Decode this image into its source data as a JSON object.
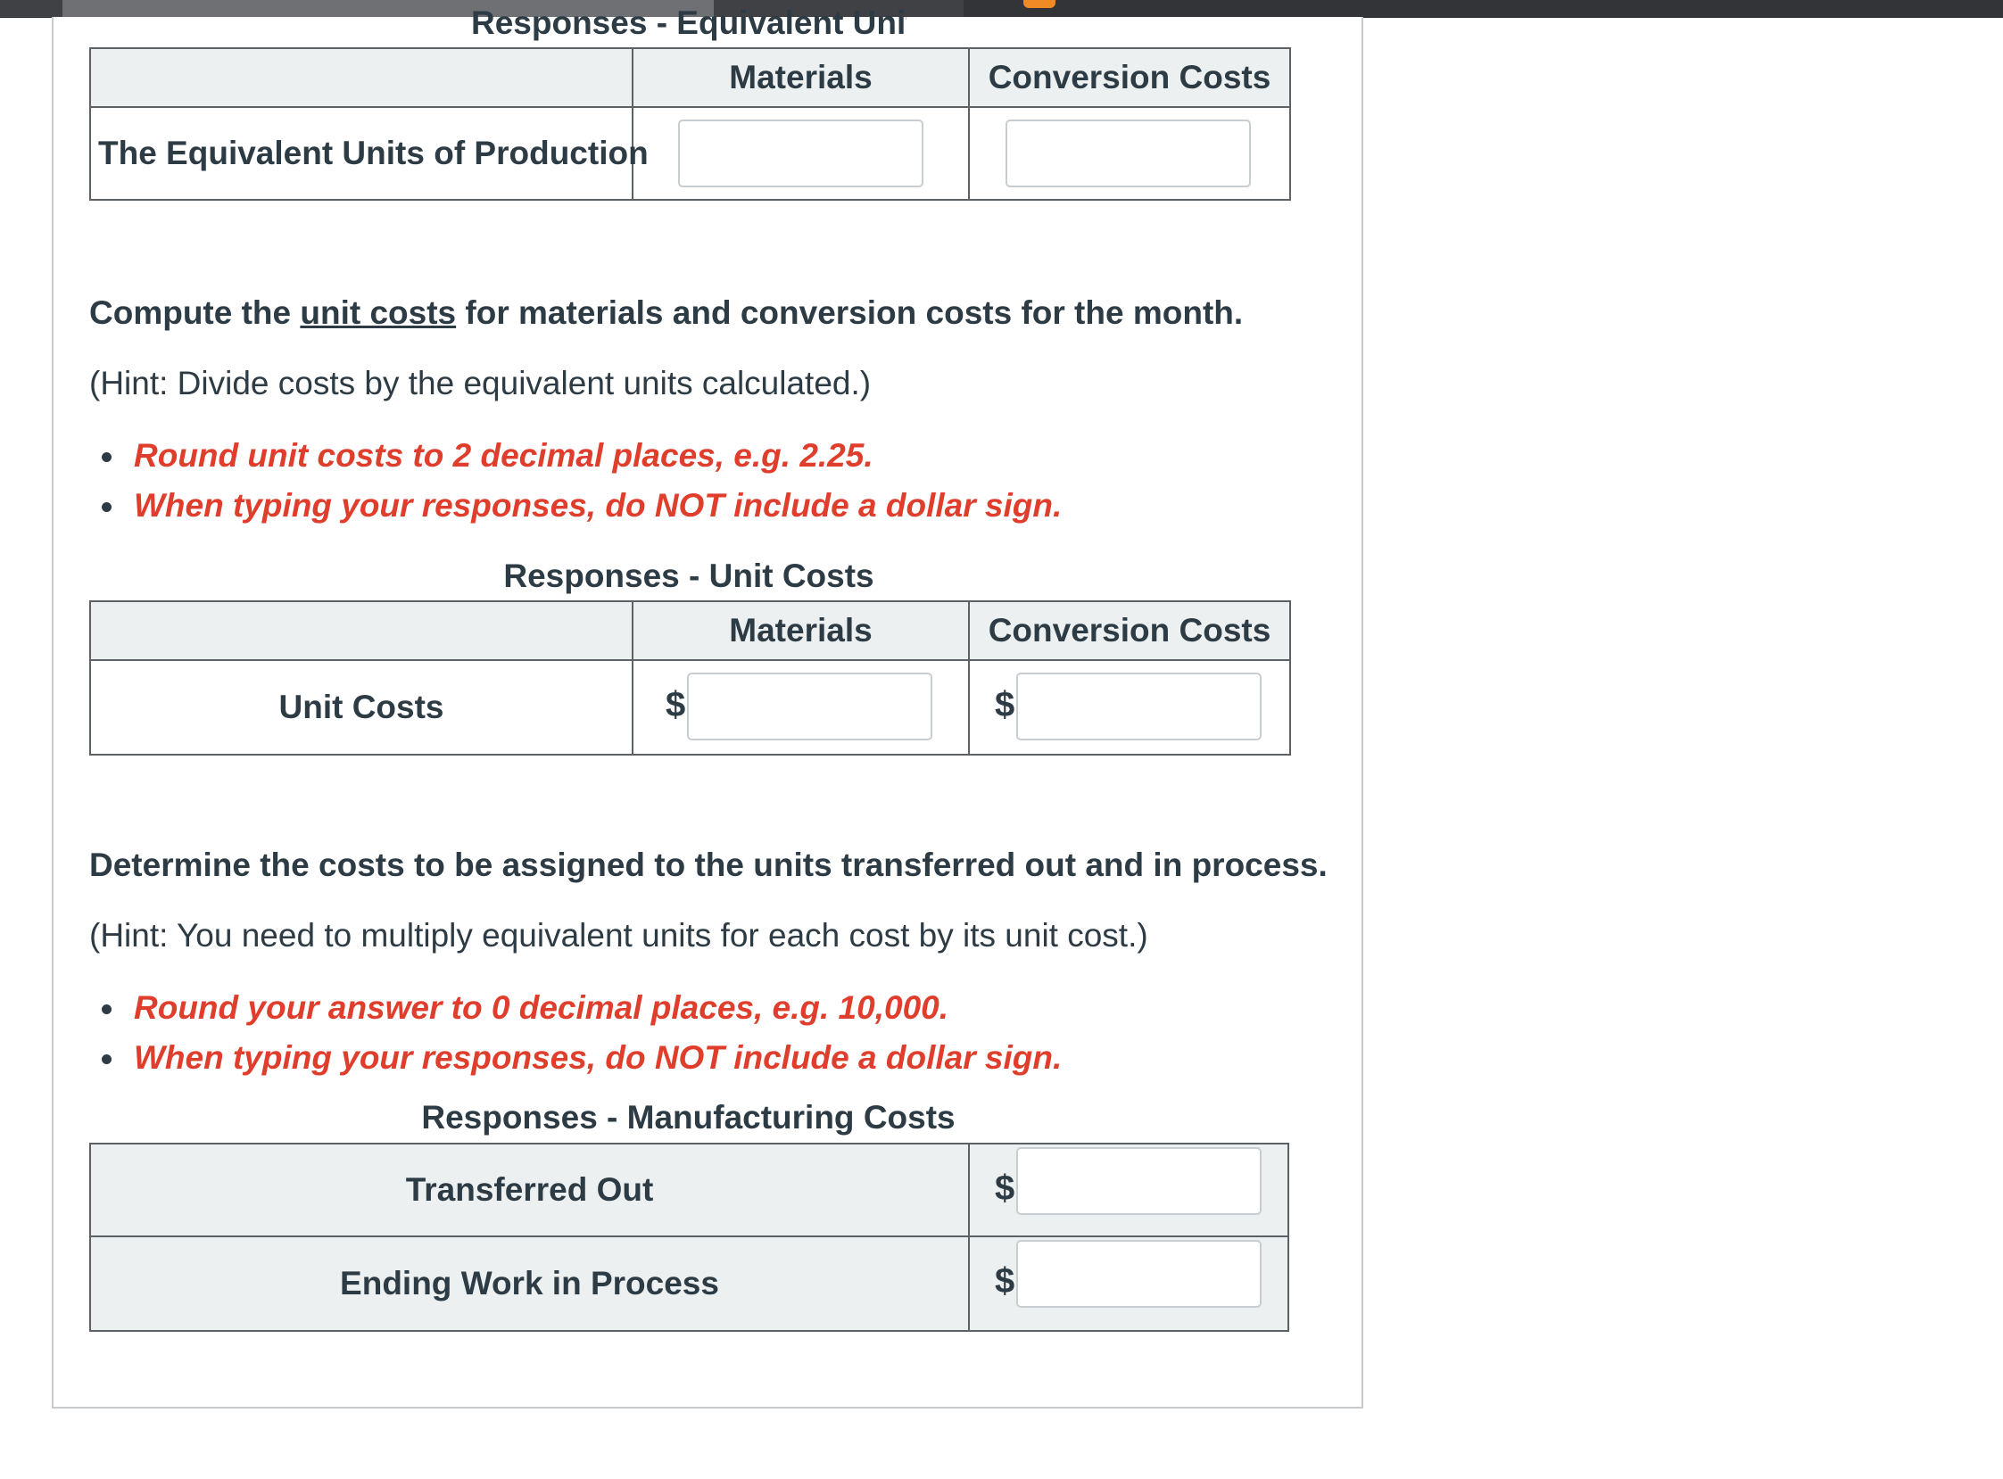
{
  "equivalent_units": {
    "caption": "Responses - Equivalent Units",
    "headers": [
      "",
      "Materials",
      "Conversion Costs"
    ],
    "row_label": "The Equivalent Units of Production",
    "materials_value": "",
    "conversion_value": ""
  },
  "unit_costs_section": {
    "instruction_prefix": "Compute the ",
    "instruction_link": "unit costs",
    "instruction_suffix": " for materials and conversion costs for the month.",
    "hint": "(Hint: Divide costs by the equivalent units calculated.)",
    "rules": [
      "Round unit costs to 2 decimal places, e.g. 2.25.",
      "When typing your responses, do NOT include a dollar sign."
    ],
    "caption": "Responses - Unit Costs",
    "headers": [
      "",
      "Materials",
      "Conversion Costs"
    ],
    "row_label": "Unit Costs",
    "currency_symbol": "$",
    "materials_value": "",
    "conversion_value": ""
  },
  "assign_costs_section": {
    "instruction": "Determine the costs to be assigned to the units transferred out and in process.",
    "hint": "(Hint: You need to multiply equivalent units for each cost by its unit cost.)",
    "rules": [
      "Round your answer to 0 decimal places, e.g. 10,000.",
      "When typing your responses, do NOT include a dollar sign."
    ],
    "caption": "Responses - Manufacturing Costs",
    "currency_symbol": "$",
    "rows": [
      {
        "label": "Transferred Out",
        "value": ""
      },
      {
        "label": "Ending Work in Process",
        "value": ""
      }
    ]
  },
  "colors": {
    "text": "#2d3b45",
    "warning_red": "#e03e2d",
    "header_shade": "#edf0f1",
    "border": "#5c6165"
  }
}
